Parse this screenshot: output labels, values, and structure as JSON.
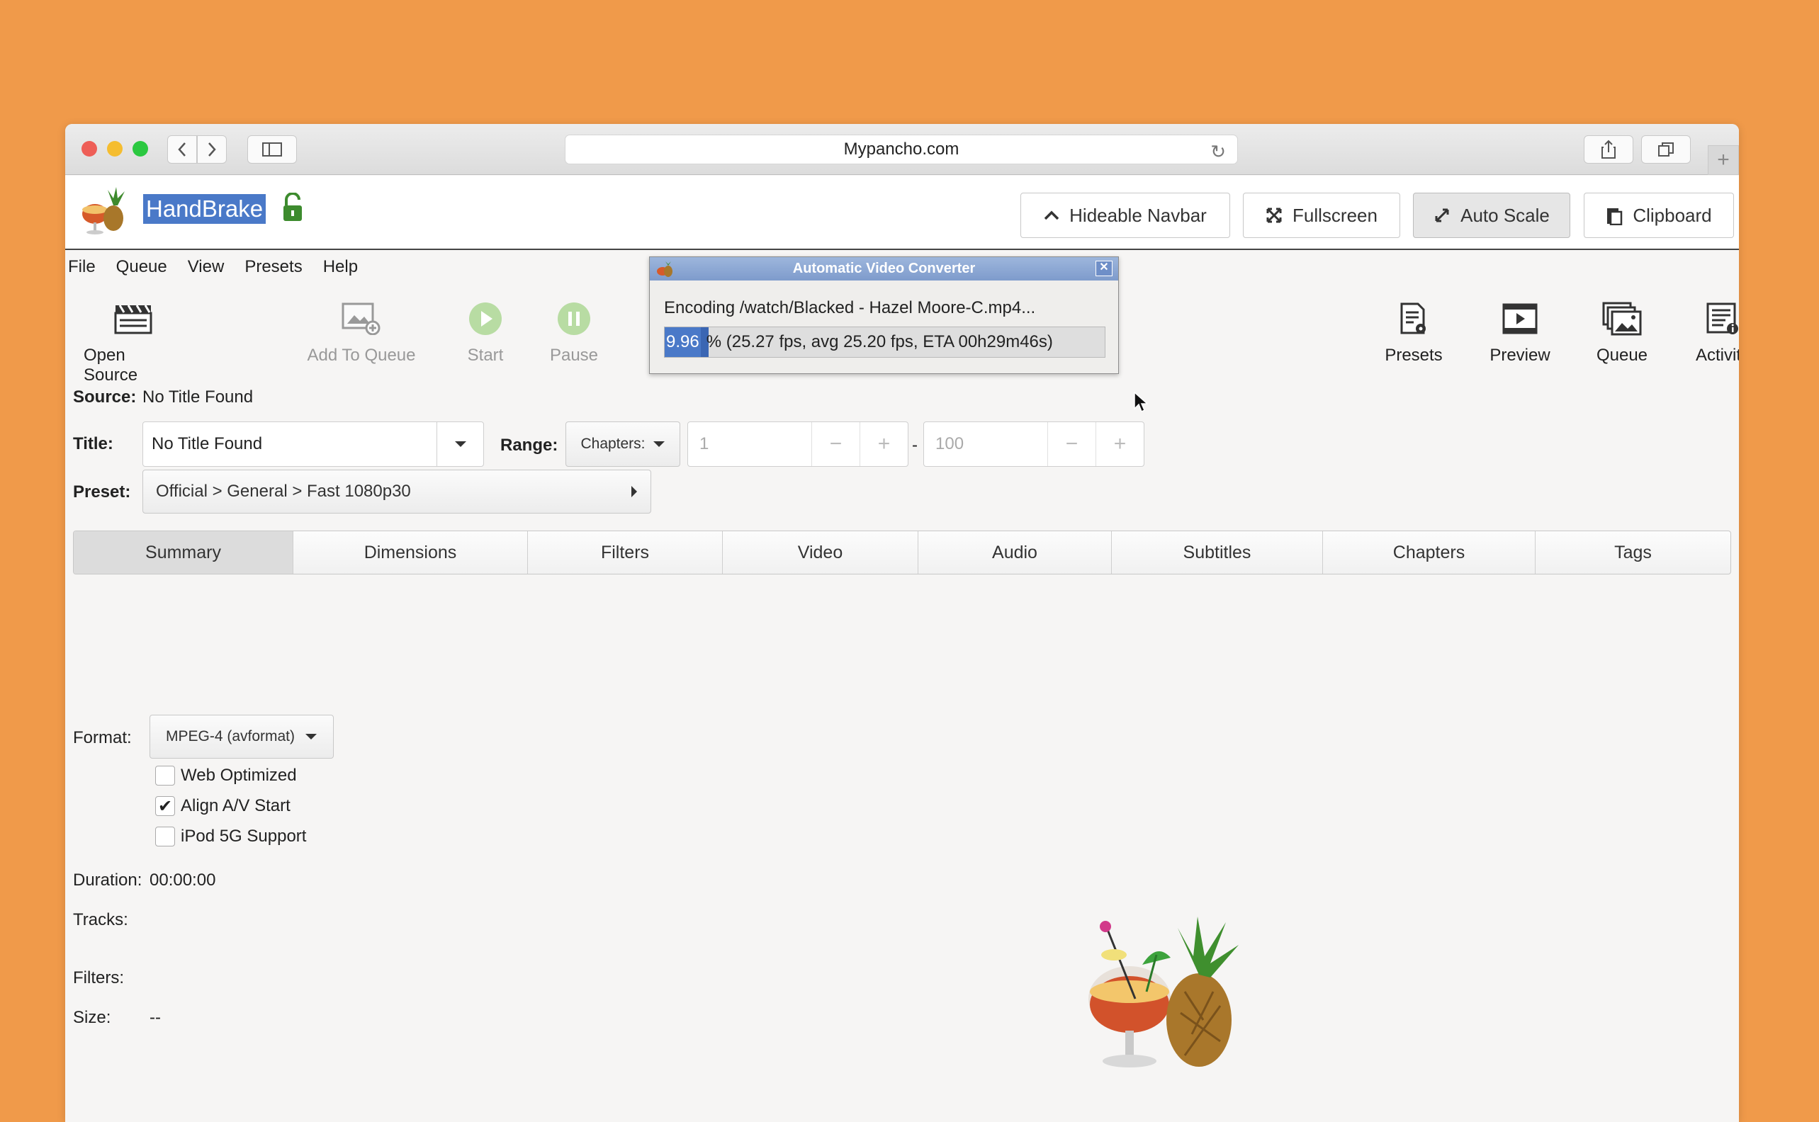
{
  "browser": {
    "url": "Mypancho.com",
    "traffic_lights": [
      "#ee5e57",
      "#f5bd30",
      "#2bc840"
    ]
  },
  "navbar": {
    "app_name": "HandBrake",
    "hideable_navbar": "Hideable Navbar",
    "fullscreen": "Fullscreen",
    "auto_scale": "Auto Scale",
    "clipboard": "Clipboard"
  },
  "menu": [
    "File",
    "Queue",
    "View",
    "Presets",
    "Help"
  ],
  "toolbar": {
    "open_source": "Open Source",
    "add_to_queue": "Add To Queue",
    "start": "Start",
    "pause": "Pause",
    "presets": "Presets",
    "preview": "Preview",
    "queue": "Queue",
    "activity": "Activity"
  },
  "source": {
    "label": "Source:",
    "value": "No Title Found"
  },
  "title": {
    "label": "Title:",
    "value": "No Title Found"
  },
  "range": {
    "label": "Range:",
    "mode": "Chapters:",
    "start": "1",
    "end": "100",
    "separator": "-"
  },
  "preset": {
    "label": "Preset:",
    "value": "Official > General > Fast 1080p30"
  },
  "tabs": [
    "Summary",
    "Dimensions",
    "Filters",
    "Video",
    "Audio",
    "Subtitles",
    "Chapters",
    "Tags"
  ],
  "active_tab": "Summary",
  "summary": {
    "format_label": "Format:",
    "format_value": "MPEG-4 (avformat)",
    "web_optimized": {
      "label": "Web Optimized",
      "checked": false
    },
    "align_av": {
      "label": "Align A/V Start",
      "checked": true
    },
    "ipod": {
      "label": "iPod 5G Support",
      "checked": false
    },
    "duration_label": "Duration:",
    "duration_value": "00:00:00",
    "tracks_label": "Tracks:",
    "filters_label": "Filters:",
    "size_label": "Size:",
    "size_value": "--"
  },
  "dialog": {
    "title": "Automatic Video Converter",
    "encoding_text": "Encoding /watch/Blacked - Hazel Moore-C.mp4...",
    "progress_pct_text": "9.96",
    "progress_rest": "% (25.27 fps, avg 25.20 fps, ETA 00h29m46s)",
    "progress_fraction": 0.0996
  },
  "icons": {
    "back": "chevron-left-icon",
    "forward": "chevron-right-icon",
    "sidebar": "sidebar-icon",
    "share": "share-icon",
    "tabs": "tabs-icon",
    "new_tab": "plus-icon",
    "lock": "unlocked-padlock-icon"
  }
}
